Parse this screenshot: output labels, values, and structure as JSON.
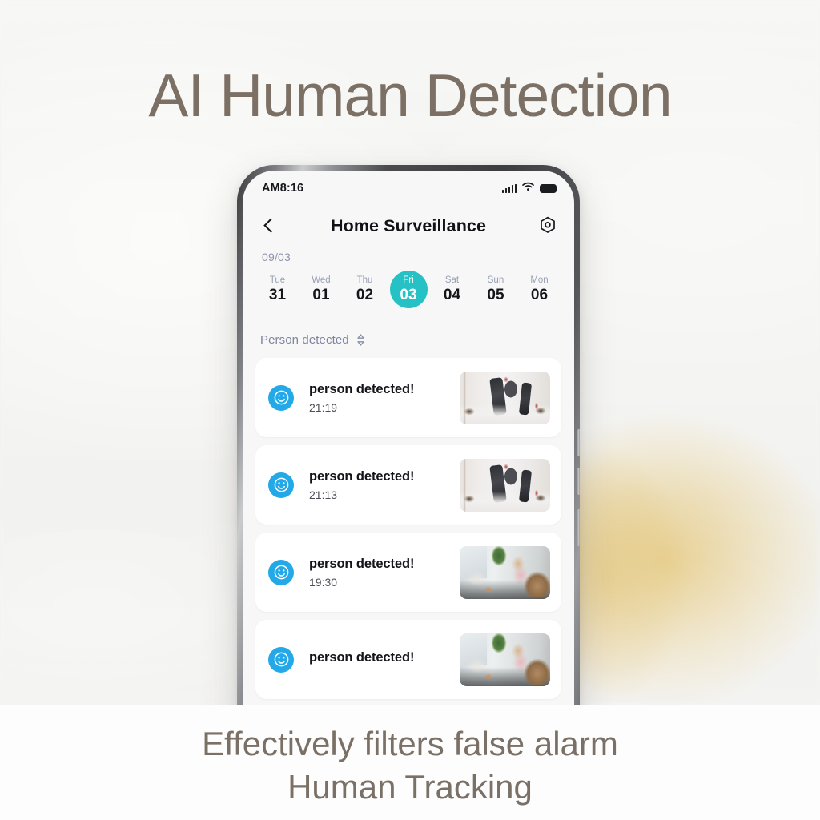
{
  "headline": "AI Human Detection",
  "caption": {
    "line1": "Effectively filters false alarm",
    "line2": "Human Tracking"
  },
  "colors": {
    "headline": "#7c7065",
    "caption": "#7a7066",
    "accent_teal": "#25c1c4",
    "event_icon_blue": "#23a9e8",
    "screen_bg": "#f7f7f8",
    "card_bg": "#ffffff",
    "muted_text": "#8f94ad"
  },
  "phone": {
    "status_bar": {
      "clock": "AM8:16",
      "icons": [
        "signal-icon",
        "wifi-icon",
        "battery-icon"
      ]
    },
    "nav": {
      "back_icon": "chevron-left-icon",
      "title": "Home  Surveillance",
      "settings_icon": "hex-gear-icon"
    },
    "date_strip": {
      "month_label": "09/03",
      "days": [
        {
          "dow": "Tue",
          "num": "31",
          "selected": false
        },
        {
          "dow": "Wed",
          "num": "01",
          "selected": false
        },
        {
          "dow": "Thu",
          "num": "02",
          "selected": false
        },
        {
          "dow": "Fri",
          "num": "03",
          "selected": true
        },
        {
          "dow": "Sat",
          "num": "04",
          "selected": false
        },
        {
          "dow": "Sun",
          "num": "05",
          "selected": false
        },
        {
          "dow": "Mon",
          "num": "06",
          "selected": false
        }
      ]
    },
    "filter": {
      "label": "Person detected",
      "sort_icon": "sort-updown-icon"
    },
    "events": [
      {
        "title": "person detected!",
        "time": "21:19",
        "icon": "smiley-face-icon",
        "thumb": "bedroom-pillow-fight"
      },
      {
        "title": "person detected!",
        "time": "21:13",
        "icon": "smiley-face-icon",
        "thumb": "bedroom-pillow-fight"
      },
      {
        "title": "person detected!",
        "time": "19:30",
        "icon": "smiley-face-icon",
        "thumb": "living-room-woman-dog"
      },
      {
        "title": "person detected!",
        "time": "",
        "icon": "smiley-face-icon",
        "thumb": "living-room-woman-dog"
      }
    ]
  }
}
